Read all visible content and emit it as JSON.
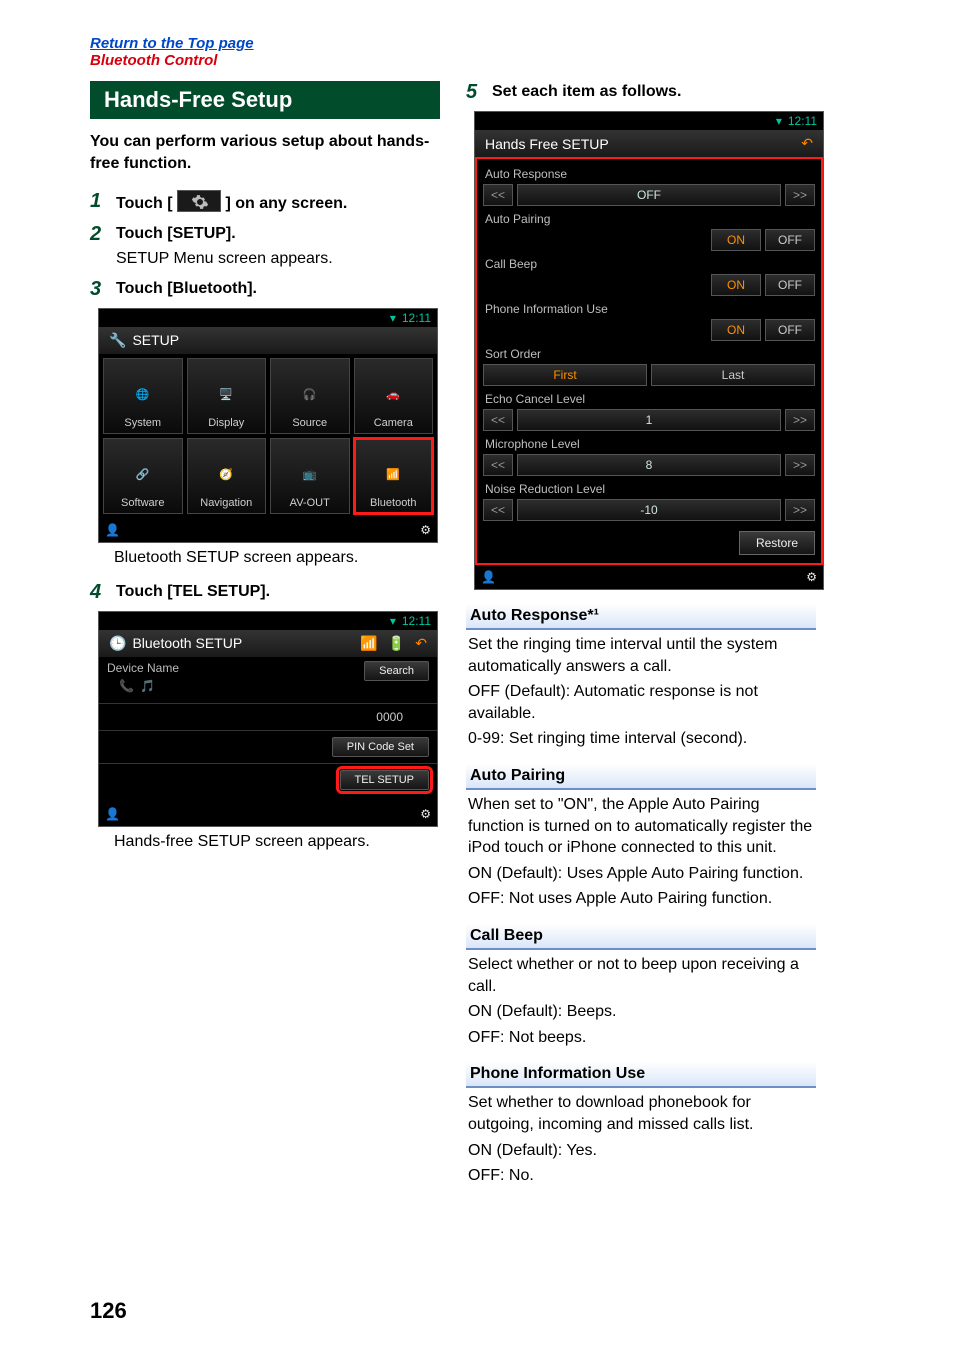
{
  "top_links": {
    "return": "Return to the Top page",
    "bluetooth": "Bluetooth Control"
  },
  "header": "Hands-Free Setup",
  "intro": "You can perform various setup about hands-free function.",
  "steps": {
    "1": {
      "pre": "Touch [ ",
      "post": " ] on any screen."
    },
    "2": {
      "title": "Touch [SETUP].",
      "sub": "SETUP Menu screen appears."
    },
    "3": {
      "title": "Touch [Bluetooth]."
    },
    "4": {
      "title": "Touch [TEL SETUP]."
    },
    "5": {
      "title": "Set each item as follows."
    }
  },
  "captions": {
    "bt_setup": "Bluetooth SETUP screen appears.",
    "hf_setup": "Hands-free SETUP screen appears."
  },
  "screens": {
    "time": "12:11",
    "setup_title": "SETUP",
    "setup_items": [
      "System",
      "Display",
      "Source",
      "Camera",
      "Software",
      "Navigation",
      "AV-OUT",
      "Bluetooth"
    ],
    "bt_title": "Bluetooth SETUP",
    "device_name_label": "Device Name",
    "search_btn": "Search",
    "pin_value": "0000",
    "pin_btn": "PIN Code Set",
    "tel_btn": "TEL SETUP",
    "hf_title": "Hands Free SETUP",
    "hf_items": {
      "auto_response": {
        "label": "Auto Response",
        "type": "slider",
        "value": "OFF"
      },
      "auto_pairing": {
        "label": "Auto Pairing",
        "type": "onoff",
        "value": "ON"
      },
      "call_beep": {
        "label": "Call Beep",
        "type": "onoff",
        "value": "ON"
      },
      "phone_info": {
        "label": "Phone Information Use",
        "type": "onoff",
        "value": "ON"
      },
      "sort_order": {
        "label": "Sort Order",
        "type": "sort",
        "options": [
          "First",
          "Last"
        ],
        "value": "First"
      },
      "echo": {
        "label": "Echo Cancel Level",
        "type": "slider",
        "value": "1"
      },
      "mic": {
        "label": "Microphone Level",
        "type": "slider",
        "value": "8"
      },
      "noise": {
        "label": "Noise Reduction Level",
        "type": "slider",
        "value": "-10"
      }
    },
    "restore": "Restore",
    "on": "ON",
    "off": "OFF",
    "left": "<<",
    "right": ">>"
  },
  "settings": {
    "auto_response": {
      "title": "Auto Response*¹",
      "desc": "Set the ringing time interval until the system automatically answers a call.",
      "opts": [
        {
          "k": "OFF (Default)",
          "v": ": Automatic response is not available."
        },
        {
          "k": "0-99",
          "v": ": Set ringing time interval (second)."
        }
      ]
    },
    "auto_pairing": {
      "title": "Auto Pairing",
      "desc": "When set to \"ON\", the Apple Auto Pairing function is turned on to automatically register the iPod touch or iPhone connected to this unit.",
      "opts": [
        {
          "k": "ON (Default)",
          "v": ": Uses Apple Auto Pairing function."
        },
        {
          "k": "OFF",
          "v": ": Not uses Apple Auto Pairing function."
        }
      ]
    },
    "call_beep": {
      "title": "Call Beep",
      "desc": "Select whether or not to beep upon receiving a call.",
      "opts": [
        {
          "k": "ON (Default)",
          "v": ": Beeps."
        },
        {
          "k": "OFF",
          "v": ": Not beeps."
        }
      ]
    },
    "phone_info": {
      "title": "Phone Information Use",
      "desc": "Set whether to download phonebook for outgoing, incoming and missed calls list.",
      "opts": [
        {
          "k": "ON (Default)",
          "v": ": Yes."
        },
        {
          "k": "OFF",
          "v": ": No."
        }
      ]
    }
  },
  "page_number": "126"
}
